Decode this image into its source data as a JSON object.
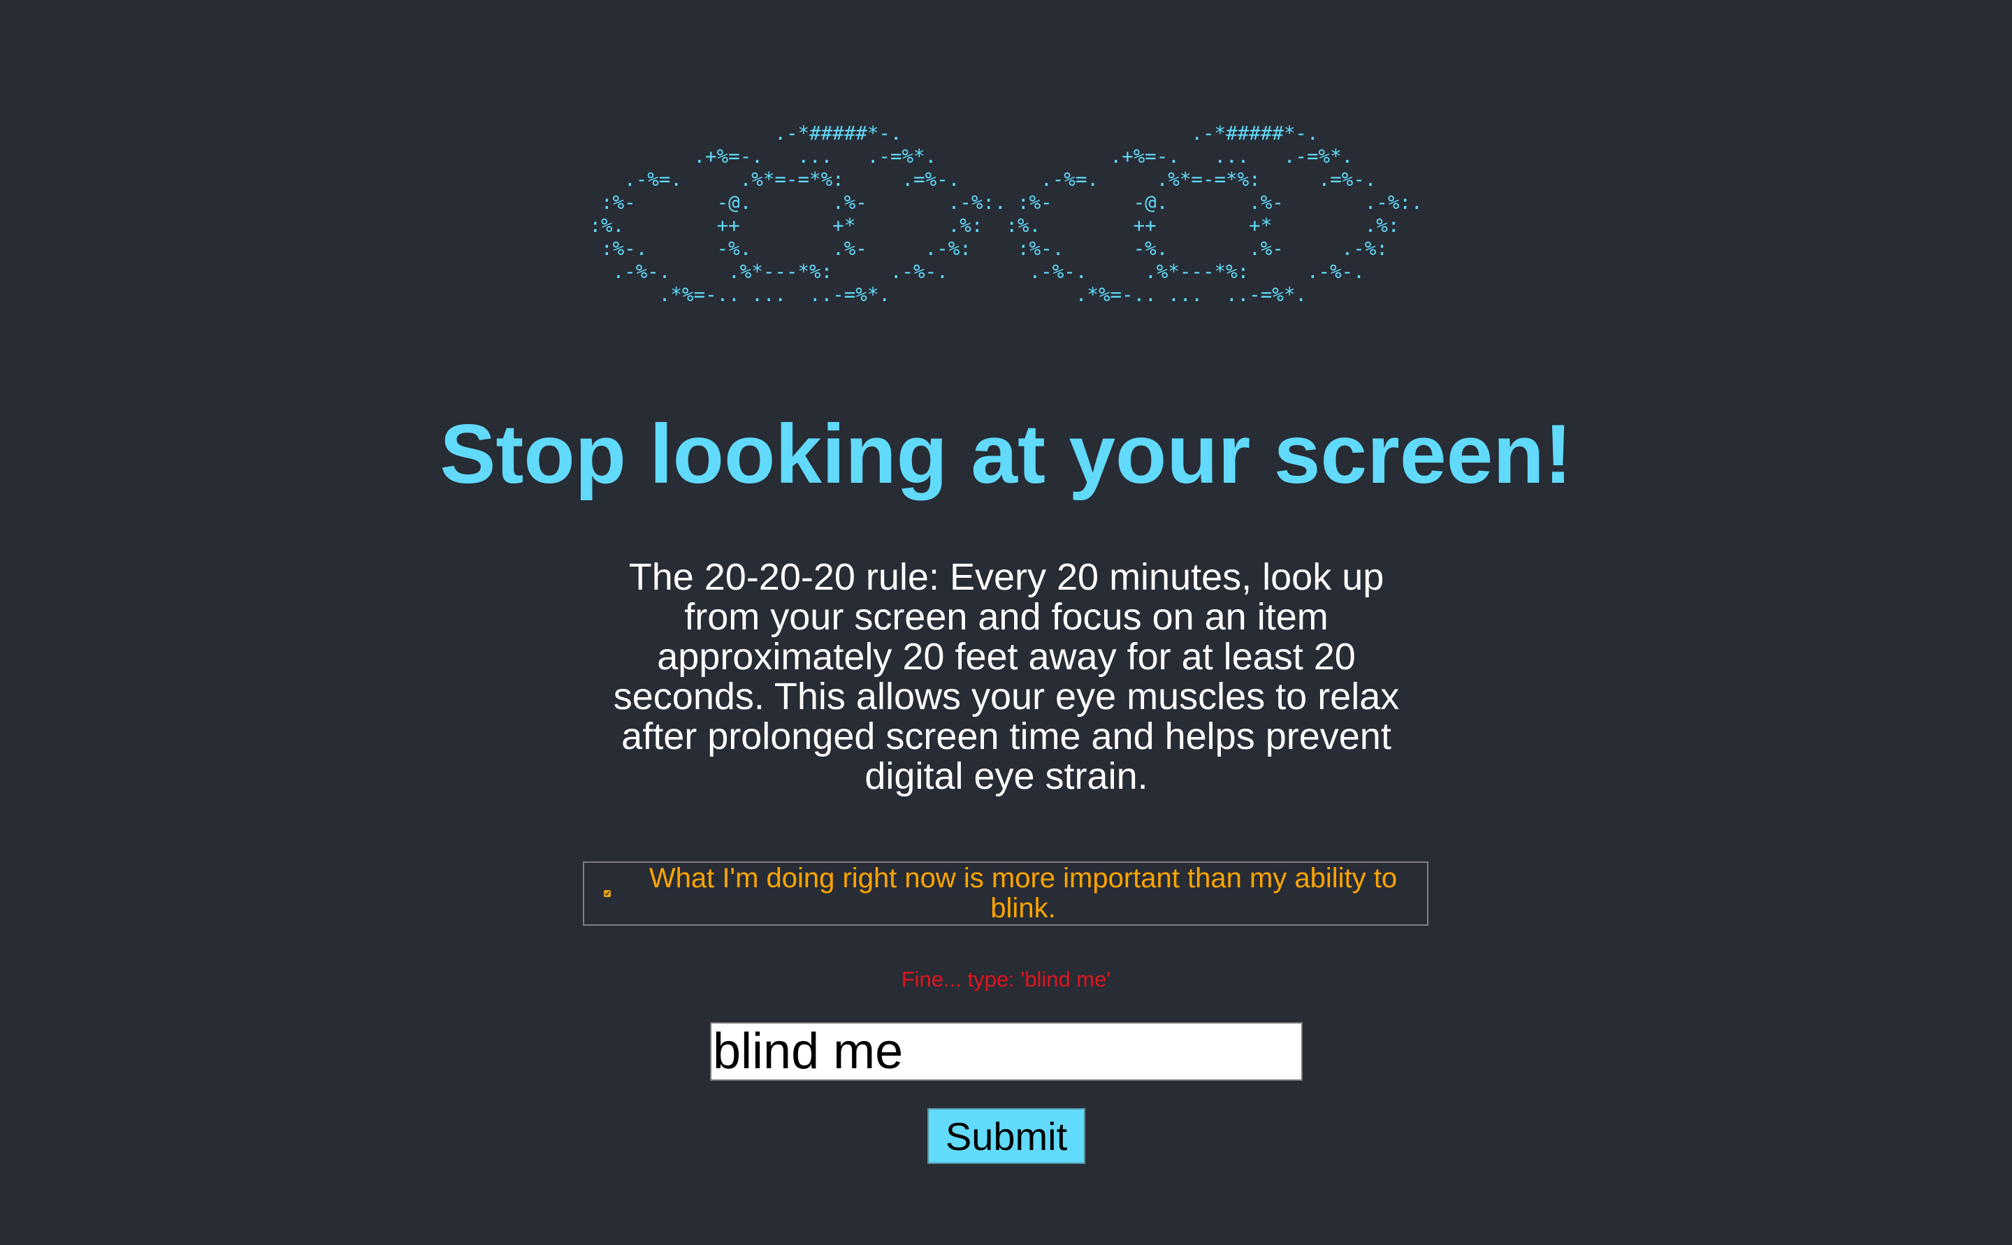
{
  "ascii_eyes": {
    "left": "                .-*#####*-.\n         .+%=-.   ...   .-=%*.\n   .-%=.     .%*=-=*%:     .=%-.\n :%-       -@.       .%-       .-%:.\n:%.        ++        +*        .%:\n :%-.      -%.       .%-     .-%:\n  .-%-.     .%*---*%:     .-%-.\n      .*%=-.. ...  ..-=%*.",
    "right": "                .-*#####*-.\n         .+%=-.   ...   .-=%*.\n   .-%=.     .%*=-=*%:     .=%-.\n :%-       -@.       .%-       .-%:.\n:%.        ++        +*        .%:\n :%-.      -%.       .%-     .-%:\n  .-%-.     .%*---*%:     .-%-.\n      .*%=-.. ...  ..-=%*."
  },
  "title": "Stop looking at your screen!",
  "rule_text": "The 20-20-20 rule: Every 20 minutes, look up from your screen and focus on an item approximately 20 feet away for at least 20 seconds. This allows your eye muscles to relax after prolonged screen time and helps prevent digital eye strain.",
  "checkbox": {
    "label": "What I'm doing right now is more important than my ability to blink.",
    "checked": true
  },
  "warning": "Fine... type: 'blind me'",
  "input": {
    "value": "blind me"
  },
  "submit_label": "Submit",
  "colors": {
    "background": "#282c34",
    "accent": "#61dafb",
    "checkbox_label": "#ffa500",
    "warning": "#e0141e",
    "body_text": "#ffffff"
  }
}
